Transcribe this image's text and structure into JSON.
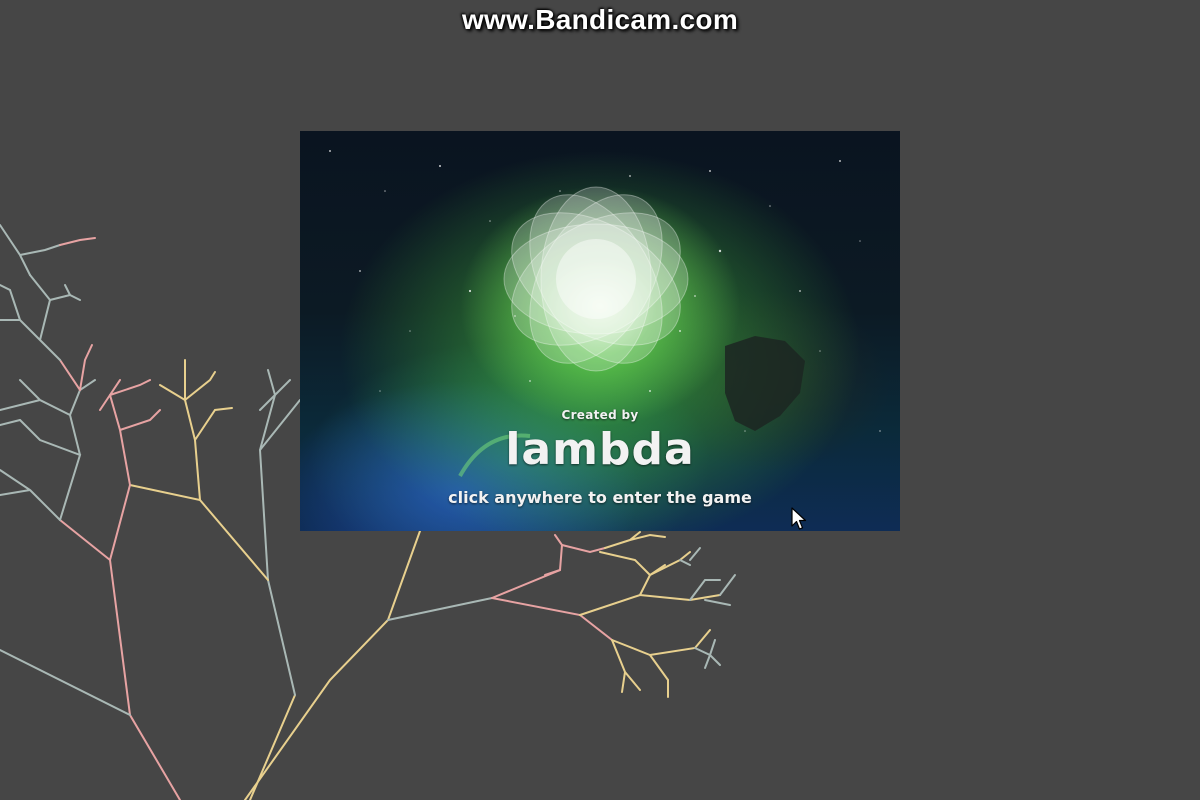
{
  "watermark": "www.Bandicam.com",
  "splash": {
    "credit_label": "Created by",
    "author": "lambda",
    "prompt": "click anywhere to enter the game"
  },
  "colors": {
    "background": "#464646",
    "branch_pink": "#e7a3a3",
    "branch_yellow": "#e8d08e",
    "branch_gray": "#a9b8b5",
    "nebula_green": "#4fcf4a"
  },
  "icons": {
    "cursor": "arrow-pointer-icon",
    "logo": "flower-of-life-icon"
  }
}
